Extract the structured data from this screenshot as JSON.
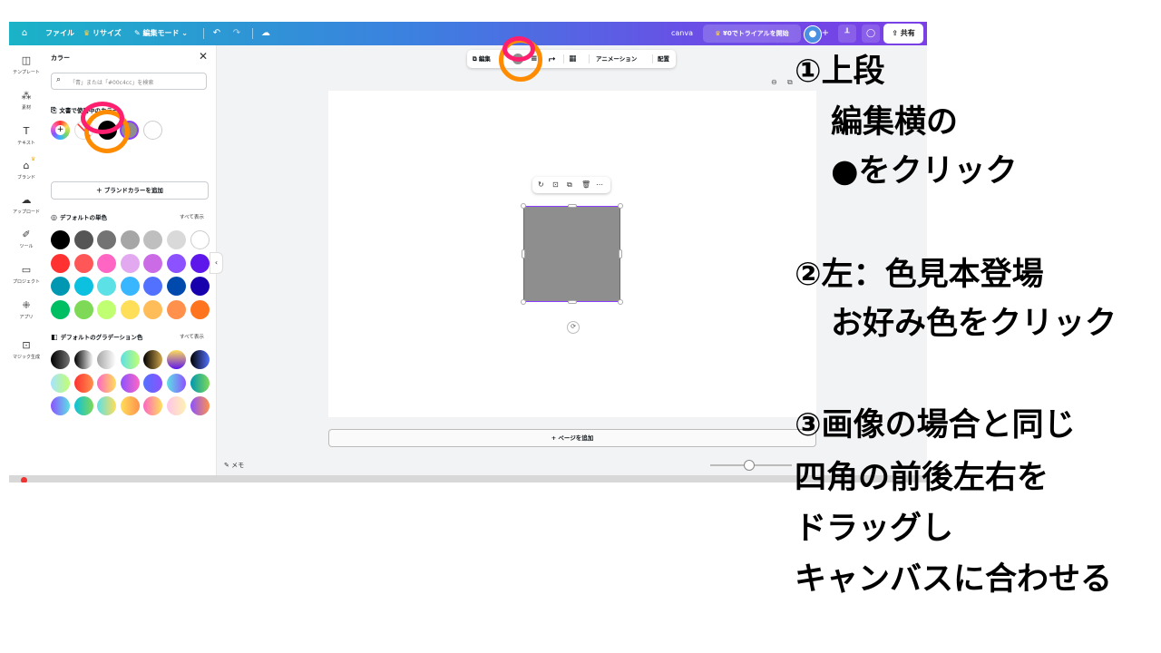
{
  "topbar": {
    "home_icon": "home-icon",
    "file": "ファイル",
    "resize": "リサイズ",
    "edit_mode": "編集モード",
    "undo_icon": "undo-icon",
    "redo_icon": "redo-icon",
    "cloud_icon": "cloud-save-icon",
    "canva_label": "canva",
    "trial_button": "¥0でトライアルを開始",
    "share": "共有"
  },
  "rail": {
    "items": [
      {
        "label": "テンプレート",
        "icon": "template-icon"
      },
      {
        "label": "素材",
        "icon": "elements-icon"
      },
      {
        "label": "テキスト",
        "icon": "text-icon"
      },
      {
        "label": "ブランド",
        "icon": "brand-icon"
      },
      {
        "label": "アップロード",
        "icon": "upload-icon"
      },
      {
        "label": "ツール",
        "icon": "tools-icon"
      },
      {
        "label": "プロジェクト",
        "icon": "folder-icon"
      },
      {
        "label": "アプリ",
        "icon": "apps-icon"
      },
      {
        "label": "マジック生成",
        "icon": "magic-icon"
      }
    ]
  },
  "color_panel": {
    "title": "カラー",
    "search_placeholder": "「青」または「#00c4cc」を検索",
    "document_colors_title": "文書で使用中のカラー",
    "add_brand_colors": "ブランドカラーを追加",
    "default_solid_title": "デフォルトの単色",
    "default_gradient_title": "デフォルトのグラデーション色",
    "show_all": "すべて表示",
    "document_colors": [
      "#000000",
      "#8e8e8e",
      "#ffffff"
    ],
    "solid_rows": [
      [
        "#000000",
        "#555555",
        "#737373",
        "#a6a6a6",
        "#bfbfbf",
        "#d9d9d9",
        "#ffffff"
      ],
      [
        "#ff3131",
        "#ff5757",
        "#ff66c4",
        "#e2a9f1",
        "#cb6ce6",
        "#8c52ff",
        "#5e17eb"
      ],
      [
        "#0097b2",
        "#0cc0df",
        "#5ce1e6",
        "#38b6ff",
        "#5271ff",
        "#004aad",
        "#1800ad"
      ],
      [
        "#00bf63",
        "#7ed957",
        "#c1ff72",
        "#ffde59",
        "#ffbd59",
        "#ff914d",
        "#ff751f"
      ]
    ],
    "gradient_rows": [
      [
        "linear-gradient(90deg,#000,#737373)",
        "linear-gradient(90deg,#000,#fff)",
        "linear-gradient(90deg,#a6a6a6,#fff)",
        "linear-gradient(90deg,#5de0e6,#c1ff72)",
        "linear-gradient(90deg,#000,#cfa54d)",
        "linear-gradient(180deg,#ffde59,#5e17eb)",
        "linear-gradient(90deg,#000,#5271ff)"
      ],
      [
        "linear-gradient(90deg,#a6e3ff,#c1ff72)",
        "linear-gradient(90deg,#ff3131,#ff914d)",
        "linear-gradient(90deg,#ff66c4,#ffde59)",
        "linear-gradient(90deg,#8c52ff,#ff66c4)",
        "linear-gradient(90deg,#5271ff,#8c52ff)",
        "linear-gradient(90deg,#5de0e6,#8c52ff)",
        "linear-gradient(90deg,#0097b2,#7ed957)"
      ],
      [
        "linear-gradient(90deg,#8c52ff,#5ce1e6)",
        "linear-gradient(90deg,#0cc0df,#7ed957)",
        "linear-gradient(90deg,#5de0e6,#ffde59)",
        "linear-gradient(90deg,#ffde59,#ff914d)",
        "linear-gradient(90deg,#ff66c4,#ffde59)",
        "linear-gradient(90deg,#ffc5e8,#fff0b3)",
        "linear-gradient(90deg,#8c52ff,#ff914d)"
      ]
    ]
  },
  "context_toolbar": {
    "edit": "編集",
    "color_icon": "fill-color-icon",
    "animation": "アニメーション",
    "position": "配置"
  },
  "canvas": {
    "shape_color": "#8e8e8e",
    "add_page": "+ ページを追加",
    "memo": "メモ"
  },
  "annotations": {
    "step1": [
      "①上段",
      "編集横の",
      "●をクリック"
    ],
    "step2": [
      "②左：色見本登場",
      "お好み色をクリック"
    ],
    "step3": [
      "③画像の場合と同じ",
      "四角の前後左右を",
      "ドラッグし",
      "キャンバスに合わせる"
    ],
    "highlight_colors": {
      "pink": "#ff1f6e",
      "orange": "#ff8c00"
    }
  }
}
